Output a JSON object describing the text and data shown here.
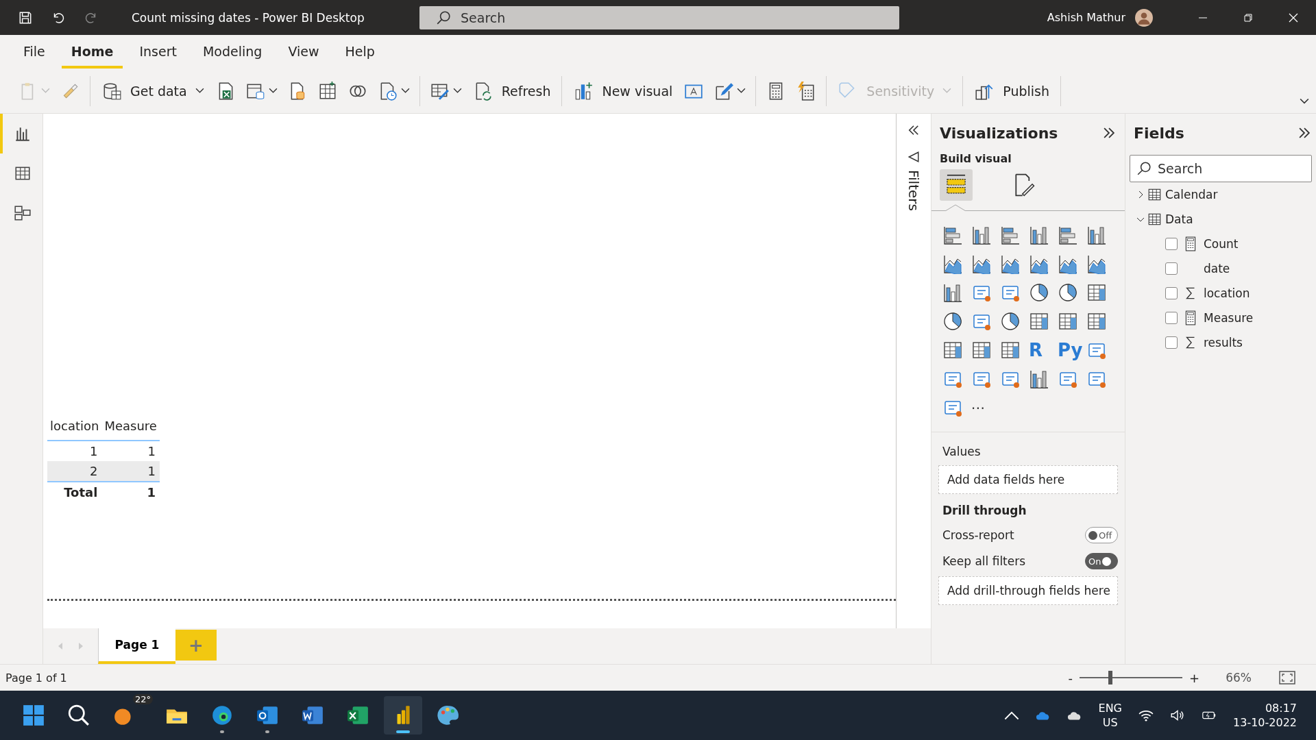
{
  "window": {
    "title": "Count missing dates - Power BI Desktop",
    "search_placeholder": "Search",
    "user": "Ashish Mathur"
  },
  "menu": [
    {
      "label": "File",
      "selected": false
    },
    {
      "label": "Home",
      "selected": true
    },
    {
      "label": "Insert",
      "selected": false
    },
    {
      "label": "Modeling",
      "selected": false
    },
    {
      "label": "View",
      "selected": false
    },
    {
      "label": "Help",
      "selected": false
    }
  ],
  "ribbon": {
    "get_data": "Get data",
    "refresh": "Refresh",
    "new_visual": "New visual",
    "sensitivity": {
      "label": "Sensitivity",
      "disabled": true
    },
    "publish": "Publish",
    "paste_disabled": true
  },
  "nav": [
    {
      "selected": true
    },
    {
      "selected": false
    },
    {
      "selected": false
    }
  ],
  "table": {
    "columns": [
      "location",
      "Measure"
    ],
    "rows": [
      [
        "1",
        "1"
      ],
      [
        "2",
        "1"
      ]
    ],
    "total": [
      "Total",
      "1"
    ]
  },
  "filters": {
    "label": "Filters"
  },
  "visualizations": {
    "title": "Visualizations",
    "subtitle": "Build visual",
    "build_tabs": [
      {
        "selected": true
      },
      {
        "selected": false
      }
    ],
    "gallery": [
      {
        "kind": "icon"
      },
      {
        "kind": "icon"
      },
      {
        "kind": "icon"
      },
      {
        "kind": "icon"
      },
      {
        "kind": "icon"
      },
      {
        "kind": "icon"
      },
      {
        "kind": "icon"
      },
      {
        "kind": "icon"
      },
      {
        "kind": "icon"
      },
      {
        "kind": "icon"
      },
      {
        "kind": "icon"
      },
      {
        "kind": "icon"
      },
      {
        "kind": "icon"
      },
      {
        "kind": "icon"
      },
      {
        "kind": "icon"
      },
      {
        "kind": "icon"
      },
      {
        "kind": "icon"
      },
      {
        "kind": "icon"
      },
      {
        "kind": "icon"
      },
      {
        "kind": "icon"
      },
      {
        "kind": "icon"
      },
      {
        "kind": "icon"
      },
      {
        "kind": "icon"
      },
      {
        "kind": "icon"
      },
      {
        "kind": "icon"
      },
      {
        "kind": "icon"
      },
      {
        "kind": "icon"
      },
      {
        "kind": "text",
        "label": "R"
      },
      {
        "kind": "text",
        "label": "Py"
      },
      {
        "kind": "icon"
      },
      {
        "kind": "icon"
      },
      {
        "kind": "icon"
      },
      {
        "kind": "icon"
      },
      {
        "kind": "icon"
      },
      {
        "kind": "icon"
      },
      {
        "kind": "icon"
      },
      {
        "kind": "icon"
      },
      {
        "kind": "text",
        "label": "⋯"
      }
    ],
    "values_label": "Values",
    "values_placeholder": "Add data fields here",
    "drill_title": "Drill through",
    "toggles": [
      {
        "label": "Cross-report",
        "on": false,
        "text": "Off"
      },
      {
        "label": "Keep all filters",
        "on": true,
        "text": "On"
      }
    ],
    "drill_placeholder": "Add drill-through fields here"
  },
  "fields": {
    "title": "Fields",
    "search_placeholder": "Search",
    "tables": [
      {
        "name": "Calendar",
        "expanded": false
      },
      {
        "name": "Data",
        "expanded": true,
        "children": [
          {
            "name": "Count",
            "kind": "measure",
            "checked": false
          },
          {
            "name": "date",
            "kind": "plain",
            "checked": false
          },
          {
            "name": "location",
            "kind": "sum",
            "checked": false
          },
          {
            "name": "Measure",
            "kind": "measure",
            "checked": false
          },
          {
            "name": "results",
            "kind": "sum",
            "checked": false
          }
        ]
      }
    ]
  },
  "pages": [
    {
      "label": "Page 1",
      "selected": true
    }
  ],
  "add_page": "+",
  "status": {
    "page": "Page 1 of 1",
    "zoom_out": "-",
    "zoom_in": "+",
    "zoom": {
      "level": 0.3,
      "reading": "66%"
    }
  },
  "taskbar": {
    "weather": "22°",
    "apps": [
      {
        "running": false,
        "selected": false
      },
      {
        "running": true,
        "selected": false
      },
      {
        "running": true,
        "selected": false
      },
      {
        "running": false,
        "selected": false
      },
      {
        "running": false,
        "selected": false
      },
      {
        "running": true,
        "selected": true
      },
      {
        "running": false,
        "selected": false
      }
    ],
    "lang": "ENG",
    "region": "US",
    "time": "08:17",
    "date": "13-10-2022"
  }
}
